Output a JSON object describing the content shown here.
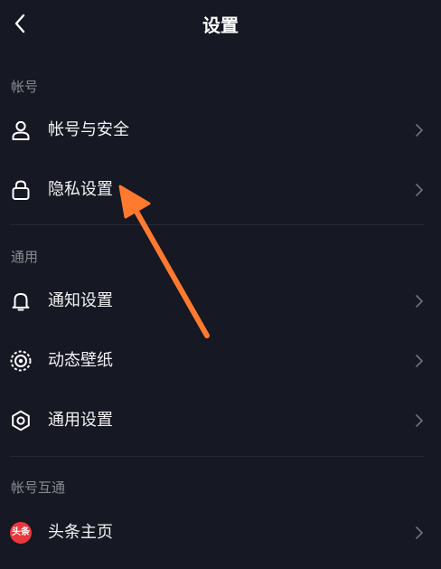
{
  "header": {
    "title": "设置",
    "back_icon": "chevron-left-icon"
  },
  "sections": [
    {
      "label": "帐号",
      "items": [
        {
          "label": "帐号与安全",
          "icon": "person-icon"
        },
        {
          "label": "隐私设置",
          "icon": "lock-icon"
        }
      ]
    },
    {
      "label": "通用",
      "items": [
        {
          "label": "通知设置",
          "icon": "bell-icon"
        },
        {
          "label": "动态壁纸",
          "icon": "wallpaper-icon"
        },
        {
          "label": "通用设置",
          "icon": "gear-icon"
        }
      ]
    },
    {
      "label": "帐号互通",
      "items": [
        {
          "label": "头条主页",
          "icon": "toutiao-logo-icon",
          "icon_text": "头条"
        }
      ]
    }
  ],
  "colors": {
    "background": "#161823",
    "section_label": "#8a8b91",
    "arrow_annotation": "#ff7a2f",
    "toutiao_red": "#e8383d"
  },
  "annotation": {
    "type": "arrow",
    "points_to": "隐私设置"
  }
}
